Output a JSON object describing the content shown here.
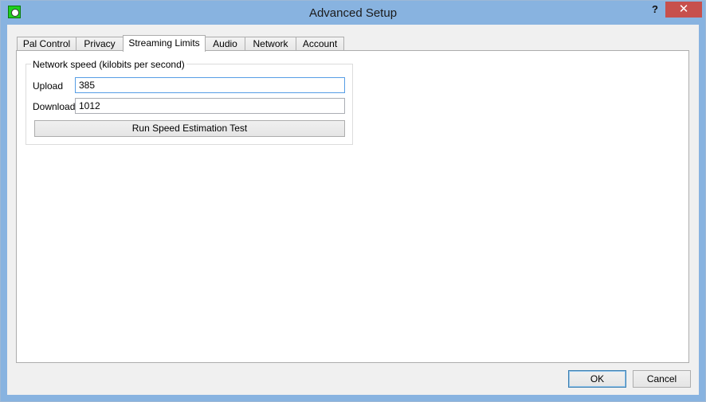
{
  "window": {
    "title": "Advanced Setup",
    "help_label": "?",
    "close_label": "✕",
    "accent_color": "#88b3e0",
    "close_color": "#c7504c"
  },
  "tabs": [
    {
      "label": "Pal Control"
    },
    {
      "label": "Privacy"
    },
    {
      "label": "Streaming Limits",
      "active": true
    },
    {
      "label": "Audio"
    },
    {
      "label": "Network"
    },
    {
      "label": "Account"
    }
  ],
  "network_speed": {
    "group_title": "Network speed (kilobits per second)",
    "upload_label": "Upload",
    "upload_value": "385",
    "download_label": "Download",
    "download_value": "1012",
    "test_button_label": "Run Speed Estimation Test"
  },
  "footer": {
    "ok_label": "OK",
    "cancel_label": "Cancel"
  }
}
